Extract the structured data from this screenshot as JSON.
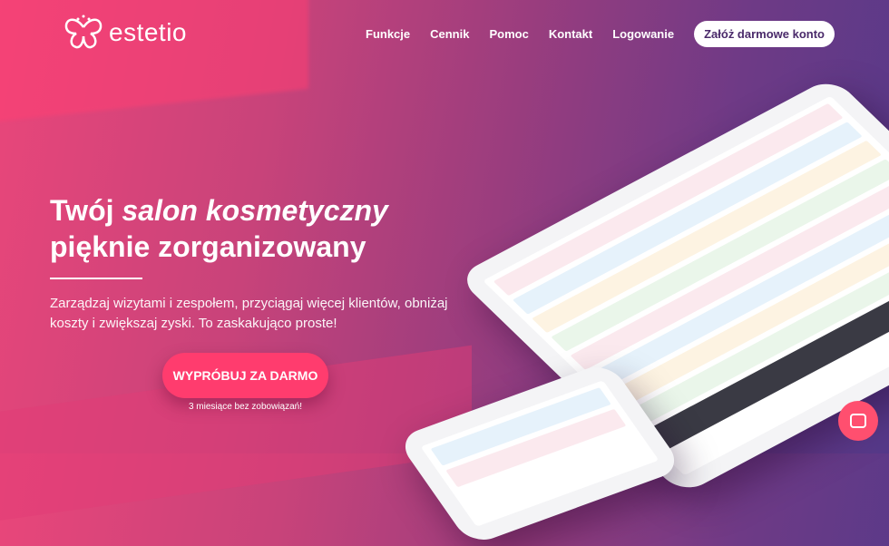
{
  "brand": {
    "name": "estetio"
  },
  "nav": {
    "items": [
      "Funkcje",
      "Cennik",
      "Pomoc",
      "Kontakt",
      "Logowanie"
    ],
    "cta": "Załóż darmowe konto"
  },
  "hero": {
    "title_1": "Twój ",
    "title_em": "salon kosmetyczny",
    "title_2": "pięknie zorganizowany",
    "description": "Zarządzaj wizytami i zespołem, przyciągaj więcej klientów, obniżaj koszty i zwiększaj zyski. To zaskakująco proste!",
    "button": "WYPRÓBUJ ZA DARMO",
    "button_note": "3 miesiące bez zobowiązań!"
  },
  "colors": {
    "accent": "#ff3c6e",
    "purple": "#553989"
  }
}
